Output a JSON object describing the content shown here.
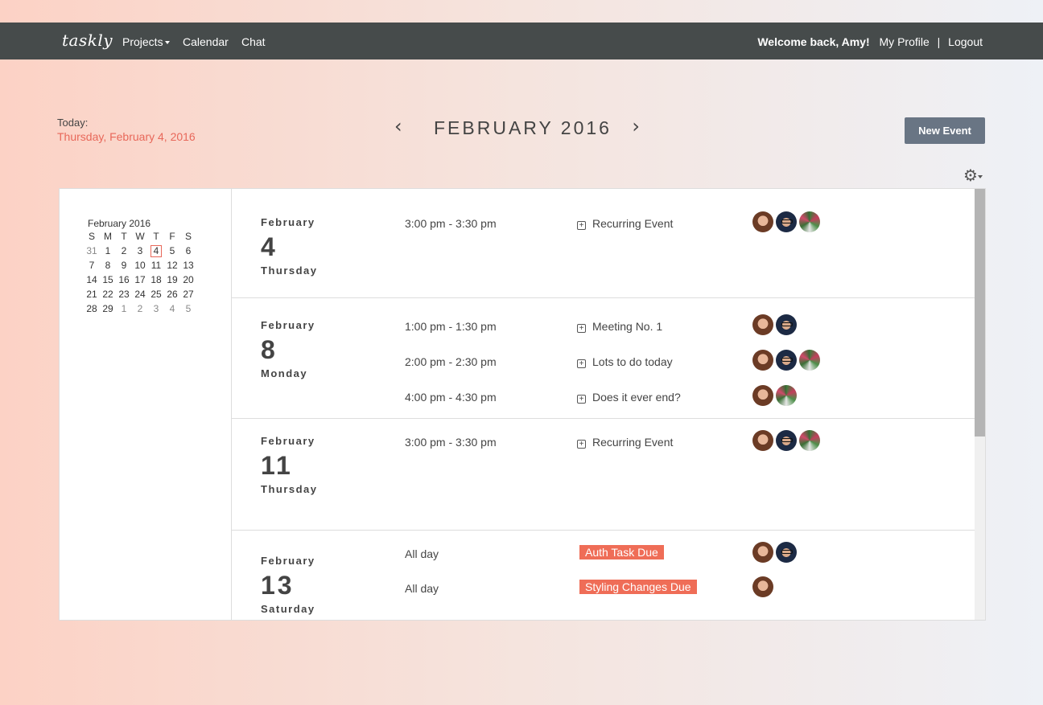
{
  "nav": {
    "brand": "taskly",
    "projects": "Projects",
    "calendar": "Calendar",
    "chat": "Chat",
    "welcome": "Welcome back, Amy!",
    "profile": "My Profile",
    "separator": "|",
    "logout": "Logout"
  },
  "today": {
    "label": "Today:",
    "date": "Thursday, February 4, 2016"
  },
  "month_nav": {
    "prev": "‹",
    "title": "FEBRUARY 2016",
    "next": "›"
  },
  "new_event_label": "New Event",
  "mini_calendar": {
    "title": "February 2016",
    "weekdays": [
      "S",
      "M",
      "T",
      "W",
      "T",
      "F",
      "S"
    ],
    "weeks": [
      [
        "31",
        "1",
        "2",
        "3",
        "4",
        "5",
        "6"
      ],
      [
        "7",
        "8",
        "9",
        "10",
        "11",
        "12",
        "13"
      ],
      [
        "14",
        "15",
        "16",
        "17",
        "18",
        "19",
        "20"
      ],
      [
        "21",
        "22",
        "23",
        "24",
        "25",
        "26",
        "27"
      ],
      [
        "28",
        "29",
        "1",
        "2",
        "3",
        "4",
        "5"
      ]
    ],
    "selected": "4"
  },
  "days": [
    {
      "month": "February",
      "num": "4",
      "weekday": "Thursday",
      "events": [
        {
          "time": "3:00 pm - 3:30 pm",
          "title": "Recurring Event",
          "kind": "event",
          "people": [
            "amy",
            "guy",
            "flower"
          ]
        }
      ]
    },
    {
      "month": "February",
      "num": "8",
      "weekday": "Monday",
      "events": [
        {
          "time": "1:00 pm - 1:30 pm",
          "title": "Meeting No. 1",
          "kind": "event",
          "people": [
            "amy",
            "guy"
          ]
        },
        {
          "time": "2:00 pm - 2:30 pm",
          "title": "Lots to do today",
          "kind": "event",
          "people": [
            "amy",
            "guy",
            "flower"
          ]
        },
        {
          "time": "4:00 pm - 4:30 pm",
          "title": "Does it ever end?",
          "kind": "event",
          "people": [
            "amy",
            "flower"
          ]
        }
      ]
    },
    {
      "month": "February",
      "num": "11",
      "weekday": "Thursday",
      "events": [
        {
          "time": "3:00 pm - 3:30 pm",
          "title": "Recurring Event",
          "kind": "event",
          "people": [
            "amy",
            "guy",
            "flower"
          ]
        }
      ]
    },
    {
      "month": "February",
      "num": "13",
      "weekday": "Saturday",
      "events": [
        {
          "time": "All day",
          "title": "Auth Task Due",
          "kind": "task",
          "people": [
            "amy",
            "guy"
          ]
        },
        {
          "time": "All day",
          "title": "Styling Changes Due",
          "kind": "task",
          "people": [
            "amy"
          ]
        }
      ]
    }
  ],
  "colors": {
    "navbar": "#464b4b",
    "accent": "#e8685a",
    "task_tag": "#ef6d57",
    "button": "#697584"
  },
  "icons": {
    "settings": "gear-icon",
    "prev": "chevron-left-icon",
    "next": "chevron-right-icon",
    "expand": "plus-square-icon"
  }
}
